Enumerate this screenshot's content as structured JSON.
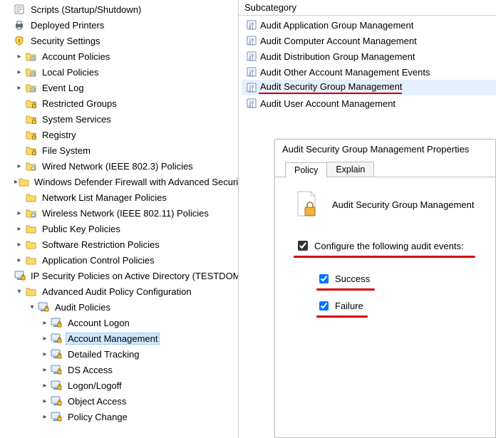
{
  "tree": {
    "scripts": "Scripts (Startup/Shutdown)",
    "deployed_printers": "Deployed Printers",
    "security_settings": "Security Settings",
    "account_policies": "Account Policies",
    "local_policies": "Local Policies",
    "event_log": "Event Log",
    "restricted_groups": "Restricted Groups",
    "system_services": "System Services",
    "registry": "Registry",
    "file_system": "File System",
    "wired_network": "Wired Network (IEEE 802.3) Policies",
    "wdf": "Windows Defender Firewall with Advanced Security",
    "nlm": "Network List Manager Policies",
    "wireless": "Wireless Network (IEEE 802.11) Policies",
    "pkp": "Public Key Policies",
    "srp": "Software Restriction Policies",
    "acp": "Application Control Policies",
    "ipsec": "IP Security Policies on Active Directory (TESTDOMAIN)",
    "aapc": "Advanced Audit Policy Configuration",
    "audit_policies": "Audit Policies",
    "account_logon": "Account Logon",
    "account_management": "Account Management",
    "detailed_tracking": "Detailed Tracking",
    "ds_access": "DS Access",
    "logon_logoff": "Logon/Logoff",
    "object_access": "Object Access",
    "policy_change": "Policy Change"
  },
  "subcat": {
    "header": "Subcategory",
    "items": [
      "Audit Application Group Management",
      "Audit Computer Account Management",
      "Audit Distribution Group Management",
      "Audit Other Account Management Events",
      "Audit Security Group Management",
      "Audit User Account Management"
    ]
  },
  "dialog": {
    "title": "Audit Security Group Management Properties",
    "tab_policy": "Policy",
    "tab_explain": "Explain",
    "policy_name": "Audit Security Group Management",
    "configure_label": "Configure the following audit events:",
    "opt_success": "Success",
    "opt_failure": "Failure"
  }
}
